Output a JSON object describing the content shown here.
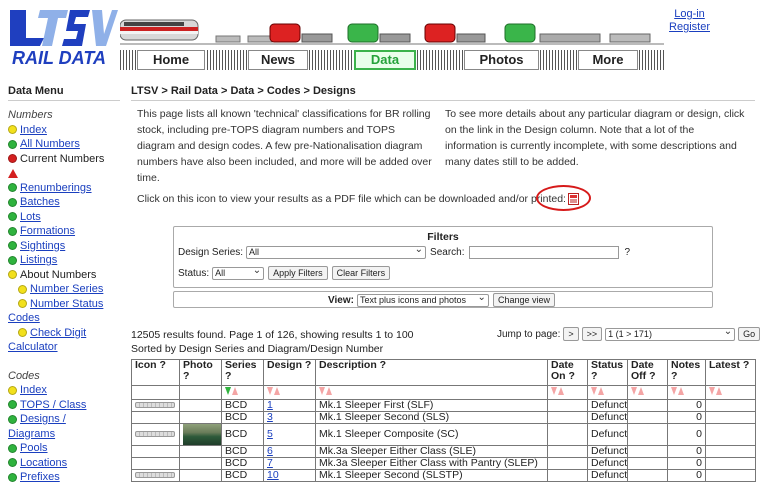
{
  "header": {
    "logo_text": "LTSV",
    "logo_subtitle": "RAIL DATA",
    "login": "Log-in",
    "register": "Register",
    "nav": [
      "Home",
      "News",
      "Data",
      "Photos",
      "More"
    ],
    "active_nav": "Data"
  },
  "sidebar": {
    "title": "Data Menu",
    "sections": [
      {
        "heading": "Numbers",
        "items": [
          {
            "label": "Index",
            "dot": "yellow",
            "link": true
          },
          {
            "label": "All Numbers",
            "dot": "green",
            "link": true
          },
          {
            "label": "Current Numbers",
            "dot": "red",
            "link": false
          },
          {
            "label": "",
            "dot": "warning",
            "link": false
          },
          {
            "label": "Renumberings",
            "dot": "green",
            "link": true
          },
          {
            "label": "Batches",
            "dot": "green",
            "link": true
          },
          {
            "label": "Lots",
            "dot": "green",
            "link": true
          },
          {
            "label": "Formations",
            "dot": "green",
            "link": true
          },
          {
            "label": "Sightings",
            "dot": "green",
            "link": true
          },
          {
            "label": "Listings",
            "dot": "green",
            "link": true
          },
          {
            "label": "About Numbers",
            "dot": "yellow",
            "link": false
          },
          {
            "label": "Number Series",
            "dot": "yellow",
            "link": true,
            "indent": true
          },
          {
            "label": "Number Status",
            "dot": "yellow",
            "link": true,
            "indent": true
          },
          {
            "label": "Codes",
            "dot": "",
            "link": true
          },
          {
            "label": "Check Digit",
            "dot": "yellow",
            "link": true,
            "indent": true
          },
          {
            "label": "Calculator",
            "dot": "",
            "link": true
          }
        ]
      },
      {
        "heading": "Codes",
        "items": [
          {
            "label": "Index",
            "dot": "yellow",
            "link": true
          },
          {
            "label": "TOPS / Class",
            "dot": "green",
            "link": true
          },
          {
            "label": "Designs /",
            "dot": "green",
            "link": true
          },
          {
            "label": "Diagrams",
            "dot": "",
            "link": true
          },
          {
            "label": "Pools",
            "dot": "green",
            "link": true
          },
          {
            "label": "Locations",
            "dot": "green",
            "link": true
          },
          {
            "label": "Prefixes",
            "dot": "green",
            "link": true
          }
        ]
      }
    ]
  },
  "main": {
    "breadcrumb": "LTSV > Rail Data > Data > Codes > Designs",
    "intro_left": "This page lists all known 'technical' classifications for BR rolling stock, including pre-TOPS diagram numbers and TOPS diagram and design codes. A few pre-Nationalisation diagram numbers have also been included, and more will be added over time.",
    "intro_right": "To see more details about any particular diagram or design, click on the link in the Design column. Note that a lot of the information is currently incomplete, with some descriptions and many dates still to be added.",
    "pdf_text": "Click on this icon to view your results as a PDF file which can be downloaded and/or printed:"
  },
  "filters": {
    "title": "Filters",
    "design_series_label": "Design Series:",
    "design_series_value": "All",
    "search_label": "Search:",
    "search_value": "",
    "help": "?",
    "status_label": "Status:",
    "status_value": "All",
    "apply_label": "Apply Filters",
    "clear_label": "Clear Filters",
    "view_label": "View:",
    "view_value": "Text plus icons and photos",
    "change_view_label": "Change view"
  },
  "results": {
    "summary": "12505 results found. Page 1 of 126, showing results 1 to 100",
    "sorted": "Sorted by Design Series and Diagram/Design Number",
    "jump_label": "Jump to page:",
    "next": ">",
    "last": ">>",
    "page_select": "1 (1 > 171)",
    "go": "Go"
  },
  "table": {
    "headers": [
      "Icon ?",
      "Photo ?",
      "Series ?",
      "Design ?",
      "Description ?",
      "Date On ?",
      "Status ?",
      "Date Off ?",
      "Notes ?",
      "Latest ?"
    ],
    "rows": [
      {
        "icon": true,
        "photo": false,
        "series": "BCD",
        "design": "1",
        "description": "Mk.1 Sleeper First (SLF)",
        "date_on": "",
        "status": "Defunct",
        "date_off": "",
        "notes": "0",
        "latest": ""
      },
      {
        "icon": false,
        "photo": false,
        "series": "BCD",
        "design": "3",
        "description": "Mk.1 Sleeper Second (SLS)",
        "date_on": "",
        "status": "Defunct",
        "date_off": "",
        "notes": "0",
        "latest": ""
      },
      {
        "icon": true,
        "photo": true,
        "series": "BCD",
        "design": "5",
        "description": "Mk.1 Sleeper Composite (SC)",
        "date_on": "",
        "status": "Defunct",
        "date_off": "",
        "notes": "0",
        "latest": ""
      },
      {
        "icon": false,
        "photo": false,
        "series": "BCD",
        "design": "6",
        "description": "Mk.3a Sleeper Either Class (SLE)",
        "date_on": "",
        "status": "Defunct",
        "date_off": "",
        "notes": "0",
        "latest": ""
      },
      {
        "icon": false,
        "photo": false,
        "series": "BCD",
        "design": "7",
        "description": "Mk.3a Sleeper Either Class with Pantry (SLEP)",
        "date_on": "",
        "status": "Defunct",
        "date_off": "",
        "notes": "0",
        "latest": ""
      },
      {
        "icon": true,
        "photo": false,
        "series": "BCD",
        "design": "10",
        "description": "Mk.1 Sleeper Second (SLSTP)",
        "date_on": "",
        "status": "Defunct",
        "date_off": "",
        "notes": "0",
        "latest": ""
      }
    ]
  },
  "colors": {
    "link": "#1a3fbf",
    "active_nav": "#3cb34a",
    "highlight_circle": "#d61a1a"
  }
}
